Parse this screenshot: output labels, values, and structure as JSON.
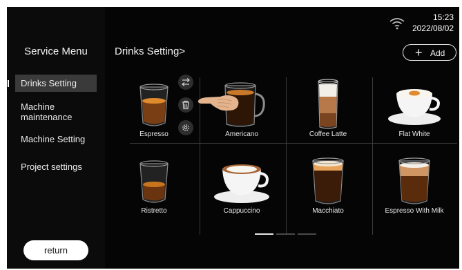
{
  "status": {
    "time": "15:23",
    "date": "2022/08/02"
  },
  "sidebar": {
    "title": "Service Menu",
    "items": [
      {
        "label": "Drinks Setting",
        "active": true
      },
      {
        "label": "Machine maintenance",
        "active": false
      },
      {
        "label": "Machine Setting",
        "active": false
      },
      {
        "label": "Project settings",
        "active": false
      }
    ],
    "return_label": "return"
  },
  "header": {
    "title": "Drinks Setting>",
    "add_label": "Add"
  },
  "drinks": [
    {
      "name": "Espresso",
      "icon": "espresso-glass-icon"
    },
    {
      "name": "Americano",
      "icon": "americano-mug-icon"
    },
    {
      "name": "Coffee Latte",
      "icon": "latte-glass-icon"
    },
    {
      "name": "Flat White",
      "icon": "flat-white-cup-icon"
    },
    {
      "name": "Ristretto",
      "icon": "ristretto-glass-icon"
    },
    {
      "name": "Cappuccino",
      "icon": "cappuccino-cup-icon"
    },
    {
      "name": "Macchiato",
      "icon": "macchiato-glass-icon"
    },
    {
      "name": "Espresso With Milk",
      "icon": "espresso-milk-glass-icon"
    }
  ],
  "tile_actions": [
    "swap-icon",
    "trash-icon",
    "gear-icon"
  ],
  "pagination": {
    "pages": 3,
    "current": 1
  },
  "colors": {
    "background": "#050505",
    "sidebar": "#0b0b0b",
    "active_item": "#3a3a3a",
    "divider": "#3c3c3c",
    "coffee": "#8a4a1c",
    "crema": "#e08a2e"
  }
}
